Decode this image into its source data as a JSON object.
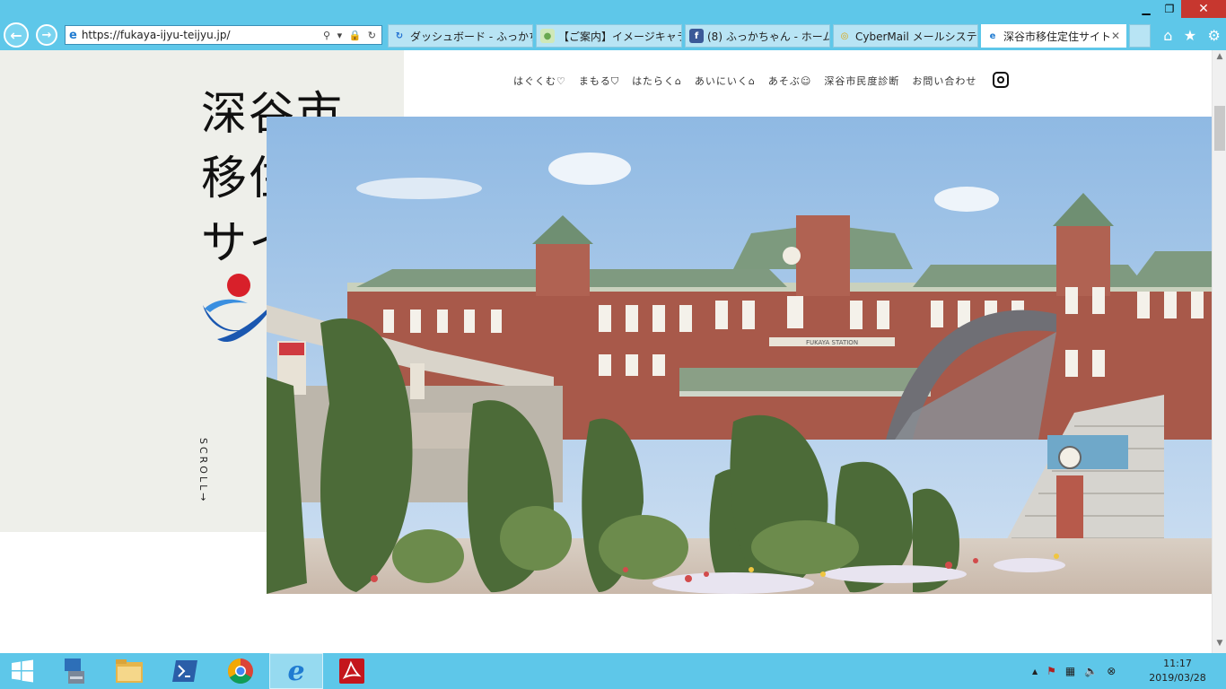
{
  "window": {
    "minimize": "▁",
    "maximize": "❐",
    "close": "✕"
  },
  "browser": {
    "back": "←",
    "forward": "→",
    "url": "https://fukaya-ijyu-teijyu.jp/",
    "address_tools": "⚲ ▾ 🔒 ↻",
    "tabs": [
      {
        "label": "ダッシュボード - ふっかちゃ...",
        "icon": "refresh-favicon-icon",
        "icon_color": "#1f6fd1"
      },
      {
        "label": "【ご案内】イメージキャラクタ...",
        "icon": "character-favicon-icon",
        "icon_color": "#6aa84f"
      },
      {
        "label": "(8) ふっかちゃん - ホーム",
        "icon": "facebook-icon",
        "icon_color": "#3b5998"
      },
      {
        "label": "CyberMail メールシステ...",
        "icon": "mail-favicon-icon",
        "icon_color": "#e0a000"
      },
      {
        "label": "深谷市移住定住サイト",
        "icon": "ie-favicon-icon",
        "icon_color": "#1f7bd1"
      }
    ],
    "tab_close": "✕",
    "home_icon": "⌂",
    "favorites_icon": "★",
    "settings_icon": "⚙"
  },
  "page": {
    "title_lines": [
      "深谷市",
      "移住定住",
      "サイト"
    ],
    "scroll_label": "SCROLL→",
    "menu": [
      {
        "label": "はぐくむ♡"
      },
      {
        "label": "まもる⛉"
      },
      {
        "label": "はたらく⌂"
      },
      {
        "label": "あいにいく⌂"
      },
      {
        "label": "あそぶ☺"
      },
      {
        "label": "深谷市民度診断"
      },
      {
        "label": "お問い合わせ"
      }
    ],
    "hero_sign": "FUKAYA STATION"
  },
  "taskbar": {
    "clock_time": "11:17",
    "clock_date": "2019/03/28",
    "tray_arrow": "▲"
  },
  "colors": {
    "chrome": "#5ec7e9",
    "panel": "#eeefea",
    "logo_red": "#d8202a",
    "logo_blue": "#1a57b0"
  }
}
